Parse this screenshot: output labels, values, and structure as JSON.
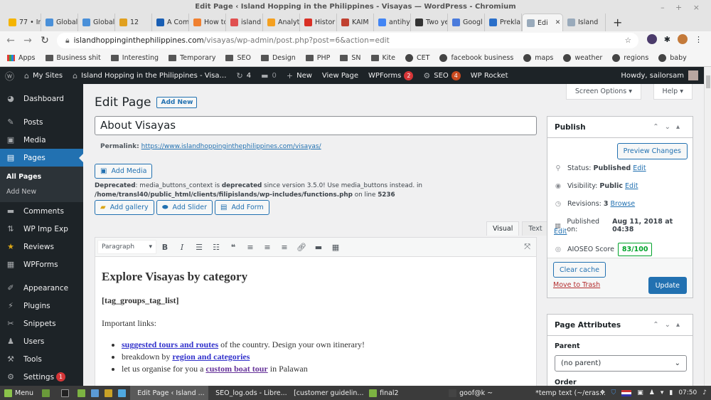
{
  "window": {
    "title": "Edit Page ‹ Island Hopping in the Philippines - Visayas — WordPress - Chromium",
    "controls": "– + ×"
  },
  "browser_tabs": [
    {
      "label": "77 • Inb",
      "color": "#f4b400"
    },
    {
      "label": "Global",
      "color": "#4a90d9"
    },
    {
      "label": "Global",
      "color": "#4a90d9"
    },
    {
      "label": "12",
      "color": "#e0a020"
    },
    {
      "label": "A Com",
      "color": "#1a5fb4"
    },
    {
      "label": "How to",
      "color": "#f08030"
    },
    {
      "label": "island",
      "color": "#e05050"
    },
    {
      "label": "Analyt",
      "color": "#f4a020"
    },
    {
      "label": "Histor",
      "color": "#d93025"
    },
    {
      "label": "KAIM",
      "color": "#c04030"
    },
    {
      "label": "antihy",
      "color": "#4285f4"
    },
    {
      "label": "Two ye",
      "color": "#333333"
    },
    {
      "label": "Googl",
      "color": "#4a7bdc"
    },
    {
      "label": "Prekla",
      "color": "#2a6fc9"
    },
    {
      "label": "Edi",
      "color": "#9ab",
      "active": true
    },
    {
      "label": "Island",
      "color": "#9ab"
    }
  ],
  "address": {
    "host": "islandhoppinginthephilippines.com",
    "path": "/visayas/wp-admin/post.php?post=6&action=edit"
  },
  "bookmarks": [
    {
      "label": "Apps",
      "type": "apps"
    },
    {
      "label": "Business shit",
      "type": "folder"
    },
    {
      "label": "Interesting",
      "type": "folder"
    },
    {
      "label": "Temporary",
      "type": "folder"
    },
    {
      "label": "SEO",
      "type": "folder"
    },
    {
      "label": "Design",
      "type": "folder"
    },
    {
      "label": "PHP",
      "type": "folder"
    },
    {
      "label": "SN",
      "type": "folder"
    },
    {
      "label": "Kite",
      "type": "folder"
    },
    {
      "label": "CET",
      "type": "globe"
    },
    {
      "label": "facebook business",
      "type": "globe"
    },
    {
      "label": "maps",
      "type": "globe"
    },
    {
      "label": "weather",
      "type": "globe"
    },
    {
      "label": "regions",
      "type": "globe"
    },
    {
      "label": "baby",
      "type": "globe"
    }
  ],
  "adminbar": {
    "my_sites": "My Sites",
    "site_name": "Island Hopping in the Philippines - Visa…",
    "updates_count": "4",
    "comments_count": "0",
    "new": "New",
    "view_page": "View Page",
    "wpforms": "WPForms",
    "wpforms_badge": "2",
    "seo": "SEO",
    "seo_badge": "4",
    "wp_rocket": "WP Rocket",
    "howdy": "Howdy, sailorsam"
  },
  "sidebar": {
    "items": [
      {
        "label": "Dashboard",
        "icon": "◕"
      },
      {
        "label": "Posts",
        "icon": "✎"
      },
      {
        "label": "Media",
        "icon": "▣"
      },
      {
        "label": "Pages",
        "icon": "▤"
      },
      {
        "label": "Comments",
        "icon": "▬"
      },
      {
        "label": "WP Imp Exp",
        "icon": "⇅"
      },
      {
        "label": "Reviews",
        "icon": "★"
      },
      {
        "label": "WPForms",
        "icon": "▦"
      },
      {
        "label": "Appearance",
        "icon": "✐"
      },
      {
        "label": "Plugins",
        "icon": "⚡"
      },
      {
        "label": "Snippets",
        "icon": "✂"
      },
      {
        "label": "Users",
        "icon": "♟"
      },
      {
        "label": "Tools",
        "icon": "⚒"
      },
      {
        "label": "Settings",
        "icon": "⚙",
        "badge": "1"
      }
    ],
    "submenu": [
      "All Pages",
      "Add New"
    ]
  },
  "header": {
    "screen_options": "Screen Options ▾",
    "help": "Help ▾",
    "title": "Edit Page",
    "add_new": "Add New"
  },
  "post": {
    "title": "About Visayas",
    "permalink_label": "Permalink:",
    "permalink_url": "https://www.islandhoppinginthephilippines.com/visayas/"
  },
  "media": {
    "add_media": "Add Media",
    "deprecated_label": "Deprecated",
    "deprecated_msg1": ": media_buttons_context is ",
    "deprecated_bold": "deprecated",
    "deprecated_msg2": " since version 3.5.0! Use media_buttons instead. in",
    "deprecated_path": "/home/transl40/public_html/clients/filipislands/wp-includes/functions.php",
    "deprecated_online": " on line ",
    "deprecated_line": "5236",
    "add_gallery": "Add gallery",
    "add_slider": "Add Slider",
    "add_form": "Add Form"
  },
  "editor": {
    "tab_visual": "Visual",
    "tab_text": "Text",
    "format": "Paragraph",
    "heading": "Explore Visayas by category",
    "shortcode": "[tag_groups_tag_list]",
    "important": "Important links:",
    "li1_link": "suggested tours and routes",
    "li1_rest": " of the country. Design your own itinerary!",
    "li2_pre": "breakdown by ",
    "li2_link": "region and categories",
    "li3_pre": "let us organise for you a ",
    "li3_link": "custom boat tour",
    "li3_rest": " in Palawan"
  },
  "publish": {
    "title": "Publish",
    "preview": "Preview Changes",
    "status_label": "Status:",
    "status_value": "Published",
    "visibility_label": "Visibility:",
    "visibility_value": "Public",
    "revisions_label": "Revisions:",
    "revisions_value": "3",
    "browse": "Browse",
    "published_label": "Published on:",
    "published_value": "Aug 11, 2018 at 04:38",
    "edit": "Edit",
    "aioseo_label": "AIOSEO Score",
    "aioseo_score": "83/100",
    "clear_cache": "Clear cache",
    "move_to_trash": "Move to Trash",
    "update": "Update"
  },
  "page_attributes": {
    "title": "Page Attributes",
    "parent_label": "Parent",
    "parent_value": "(no parent)",
    "order_label": "Order"
  },
  "taskbar": {
    "menu": "Menu",
    "windows": [
      {
        "label": "Edit Page ‹ Island ...",
        "active": true,
        "color": "#6aa0d8"
      },
      {
        "label": "SEO_log.ods - Libre...",
        "color": "#3fae49"
      },
      {
        "label": "[customer guidelin...",
        "color": "#2a6fc9"
      },
      {
        "label": "final2",
        "color": "#7cb342"
      },
      {
        "label": "goof@k ~",
        "color": "#444"
      },
      {
        "label": "*temp text (~/eras...",
        "color": "#e8d9a0"
      }
    ],
    "clock": "07:50"
  }
}
